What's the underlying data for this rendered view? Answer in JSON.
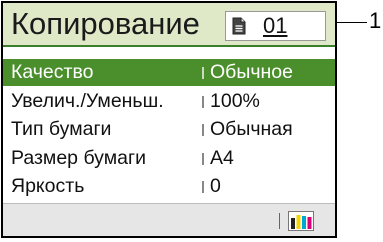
{
  "title": "Копирование",
  "copies": "01",
  "settings": [
    {
      "label": "Качество",
      "value": "Обычное",
      "selected": true
    },
    {
      "label": "Увелич./Уменьш.",
      "value": "100%",
      "selected": false
    },
    {
      "label": "Тип бумаги",
      "value": "Обычная",
      "selected": false
    },
    {
      "label": "Размер бумаги",
      "value": "A4",
      "selected": false
    },
    {
      "label": "Яркость",
      "value": "0",
      "selected": false
    }
  ],
  "callout": "1",
  "icons": {
    "copies": "document-icon",
    "ink": "ink-level-icon"
  },
  "colors": {
    "title_bg": "#dfe9c8",
    "selected_row": "#4b8f2d",
    "status_bg": "#e6e6e6"
  }
}
